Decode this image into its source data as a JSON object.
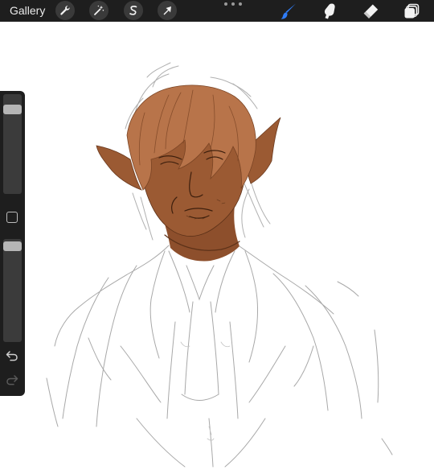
{
  "toolbar": {
    "gallery_label": "Gallery",
    "left_tools": [
      {
        "name": "actions",
        "icon": "wrench-icon"
      },
      {
        "name": "adjustments",
        "icon": "magic-wand-icon"
      },
      {
        "name": "selection",
        "icon": "selection-s-icon"
      },
      {
        "name": "transform",
        "icon": "arrow-cursor-icon"
      }
    ],
    "right_tools": [
      {
        "name": "brush",
        "icon": "brush-icon",
        "active": true
      },
      {
        "name": "smudge",
        "icon": "smudge-finger-icon",
        "active": false
      },
      {
        "name": "eraser",
        "icon": "eraser-icon",
        "active": false
      },
      {
        "name": "layers",
        "icon": "layers-icon",
        "active": false
      }
    ],
    "more_icon": "more-dots-icon"
  },
  "sidebar": {
    "brush_size_level": 0.88,
    "opacity_level": 0.97,
    "modify_icon": "square-modify-icon",
    "undo_icon": "undo-icon",
    "redo_icon": "redo-icon"
  },
  "colors": {
    "toolbar_bg": "#1e1e1e",
    "accent_brush": "#2f7cf6",
    "skin_fill": "#9b5a33",
    "hair_fill": "#b8744a",
    "sketch_line": "#a8a8a8"
  }
}
